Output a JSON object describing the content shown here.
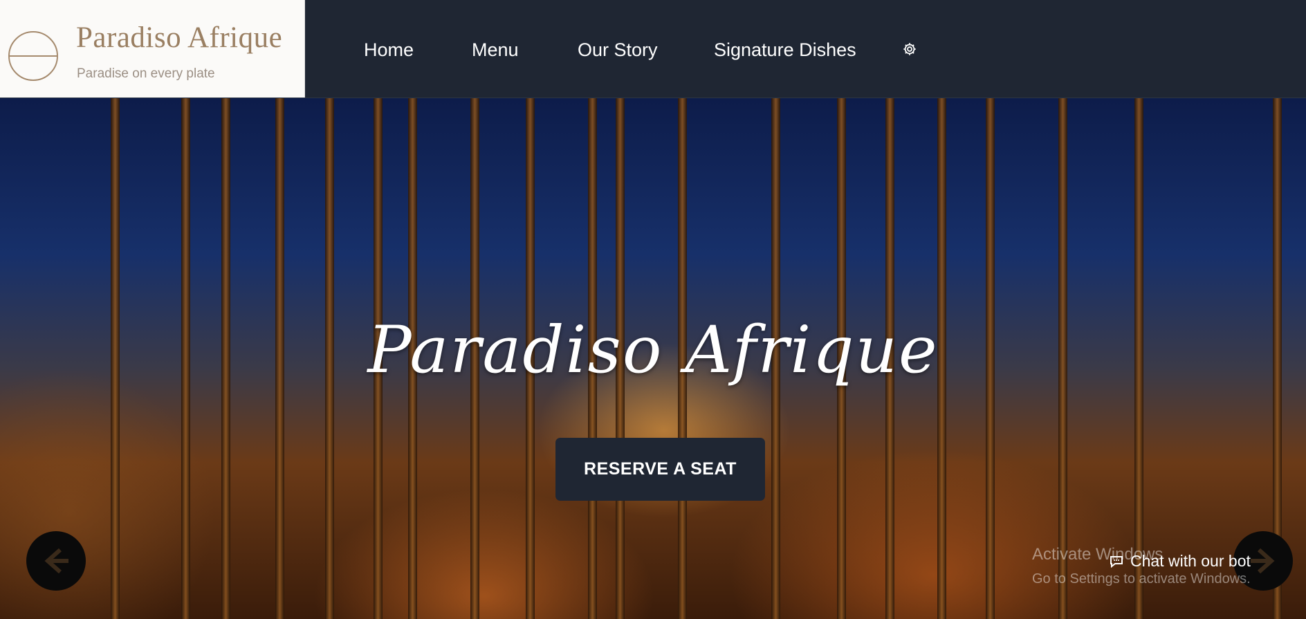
{
  "brand": {
    "name": "Paradiso Afrique",
    "tagline": "Paradise on every plate"
  },
  "nav": {
    "items": [
      {
        "label": "Home"
      },
      {
        "label": "Menu"
      },
      {
        "label": "Our Story"
      },
      {
        "label": "Signature Dishes"
      }
    ],
    "settings_icon": "gear-icon"
  },
  "hero": {
    "title": "Paradiso Afrique",
    "cta_label": "RESERVE A SEAT",
    "prev_icon": "arrow-left-icon",
    "next_icon": "arrow-right-icon"
  },
  "overlay": {
    "windows_line1": "Activate Windows",
    "windows_line2": "Go to Settings to activate Windows.",
    "chat_label": "Chat with our bot",
    "chat_icon": "chat-icon"
  },
  "colors": {
    "header_bg": "#1f2633",
    "brand_text": "#9a7f62",
    "button_bg": "#1f2633"
  }
}
